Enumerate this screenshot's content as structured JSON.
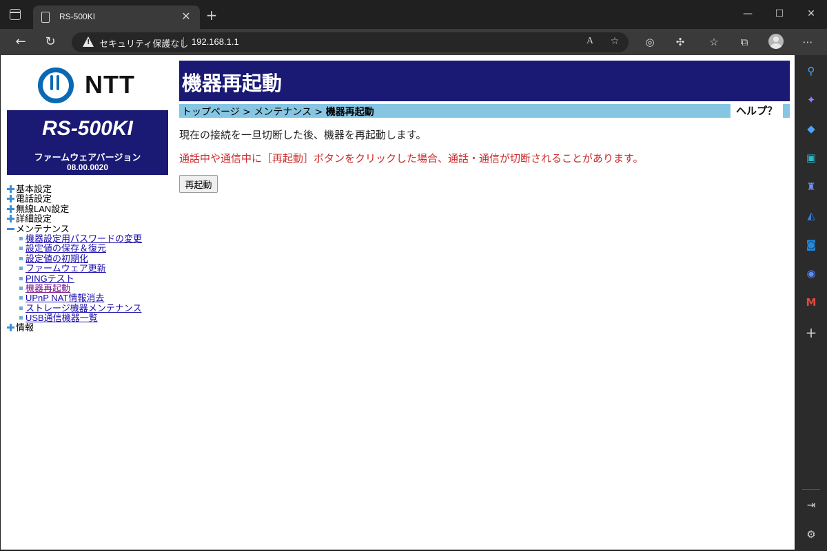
{
  "browser": {
    "tab_title": "RS-500KI",
    "tab_close": "✕",
    "new_tab": "+",
    "security_text": "セキュリティ保護なし",
    "url": "192.168.1.1",
    "window_controls": {
      "minimize": "—",
      "maximize": "☐",
      "close": "✕"
    },
    "nav_icons": {
      "back": "arrow-left-icon",
      "refresh": "refresh-icon"
    },
    "toolbar_icons": [
      "read-aloud-icon",
      "favorite-add-icon",
      "extension-icon",
      "puzzle-icon",
      "favorites-icon",
      "collections-icon",
      "profile-avatar",
      "more-icon"
    ],
    "sidebar_icons": [
      "search-icon",
      "copilot-icon",
      "shopping-icon",
      "tools-icon",
      "games-icon",
      "bing-icon",
      "outlook-icon",
      "messenger-icon",
      "gmail-icon",
      "add-icon",
      "split-screen-icon",
      "settings-icon"
    ]
  },
  "logo": {
    "text": "NTT"
  },
  "device": {
    "model": "RS-500KI",
    "firmware_label": "ファームウェアバージョン",
    "firmware_version": "08.00.0020"
  },
  "menu": {
    "basic": "基本設定",
    "phone": "電話設定",
    "wlan": "無線LAN設定",
    "advanced": "詳細設定",
    "maintenance": "メンテナンス",
    "maintenance_items": [
      "機器設定用パスワードの変更",
      "設定値の保存＆復元",
      "設定値の初期化",
      "ファームウェア更新",
      "PINGテスト",
      "機器再起動",
      "UPnP NAT情報消去",
      "ストレージ機器メンテナンス",
      "USB通信機器一覧"
    ],
    "info": "情報"
  },
  "main": {
    "title": "機器再起動",
    "breadcrumb": {
      "top": "トップページ",
      "sep": " > ",
      "maintenance": "メンテナンス",
      "current": "機器再起動"
    },
    "help": "ヘルプ？",
    "description": "現在の接続を一旦切断した後、機器を再起動します。",
    "warning": "通話中や通信中に［再起動］ボタンをクリックした場合、通話・通信が切断されることがあります。",
    "reboot_button": "再起動"
  },
  "colors": {
    "header_navy": "#1a1a75",
    "breadcrumb_blue": "#86c6e3",
    "warning_red": "#cc2a2a",
    "ntt_blue": "#0a69b4"
  }
}
